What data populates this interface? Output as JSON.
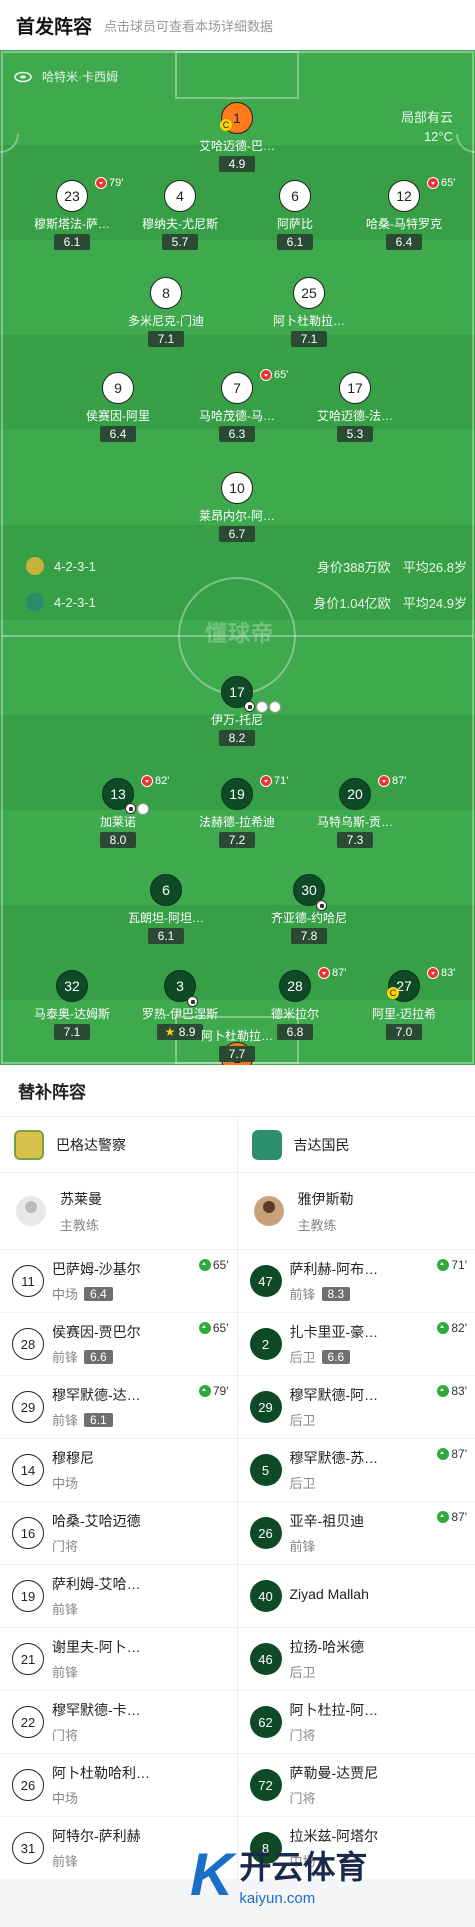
{
  "header": {
    "title": "首发阵容",
    "subtitle": "点击球员可查看本场详细数据"
  },
  "pitch": {
    "venue": "哈特米·卡西姆",
    "weather": {
      "condition": "局部有云",
      "temp": "12°C"
    },
    "watermark": "懂球帝",
    "home_team_row": {
      "formation": "4-2-3-1",
      "value": "身价388万欧",
      "avg_age": "平均26.8岁"
    },
    "away_team_row": {
      "formation": "4-2-3-1",
      "value": "身价1.04亿欧",
      "avg_age": "平均24.9岁"
    }
  },
  "home_players": [
    {
      "num": "1",
      "name": "艾哈迈德-巴…",
      "rating": "4.9",
      "captain": "C"
    },
    {
      "num": "23",
      "name": "穆斯塔法-萨…",
      "rating": "6.1",
      "sub_minute": "79'"
    },
    {
      "num": "4",
      "name": "穆纳夫-尤尼斯",
      "rating": "5.7"
    },
    {
      "num": "6",
      "name": "阿萨比",
      "rating": "6.1"
    },
    {
      "num": "12",
      "name": "哈桑-马特罗克",
      "rating": "6.4",
      "sub_minute": "65'"
    },
    {
      "num": "8",
      "name": "多米尼克-门迪",
      "rating": "7.1"
    },
    {
      "num": "25",
      "name": "阿卜杜勒拉…",
      "rating": "7.1"
    },
    {
      "num": "9",
      "name": "侯赛因-阿里",
      "rating": "6.4"
    },
    {
      "num": "7",
      "name": "马哈茂德-马…",
      "rating": "6.3",
      "sub_minute": "65'"
    },
    {
      "num": "17",
      "name": "艾哈迈德-法…",
      "rating": "5.3"
    },
    {
      "num": "10",
      "name": "莱昂内尔-阿…",
      "rating": "6.7"
    }
  ],
  "away_players": [
    {
      "num": "17",
      "name": "伊万-托尼",
      "rating": "8.2"
    },
    {
      "num": "13",
      "name": "加莱诺",
      "rating": "8.0",
      "sub_minute": "82'"
    },
    {
      "num": "19",
      "name": "法赫德-拉希迪",
      "rating": "7.2",
      "sub_minute": "71'"
    },
    {
      "num": "20",
      "name": "马特乌斯-贡…",
      "rating": "7.3",
      "sub_minute": "87'"
    },
    {
      "num": "6",
      "name": "瓦朗坦-阿坦…",
      "rating": "6.1"
    },
    {
      "num": "30",
      "name": "齐亚德-约哈尼",
      "rating": "7.8"
    },
    {
      "num": "32",
      "name": "马泰奥-达姆斯",
      "rating": "7.1"
    },
    {
      "num": "3",
      "name": "罗热-伊巴涅斯",
      "rating": "8.9"
    },
    {
      "num": "28",
      "name": "德米拉尔",
      "rating": "6.8",
      "sub_minute": "87'"
    },
    {
      "num": "27",
      "name": "阿里-迈拉希",
      "rating": "7.0",
      "sub_minute": "83'",
      "captain": "C"
    },
    {
      "num": "1",
      "name": "阿卜杜勒拉…",
      "rating": "7.7"
    }
  ],
  "subs": {
    "title": "替补阵容",
    "home": {
      "team": "巴格达警察",
      "coach": {
        "name": "苏莱曼",
        "role": "主教练"
      },
      "players": [
        {
          "num": "11",
          "name": "巴萨姆-沙基尔",
          "pos": "中场",
          "rating": "6.4",
          "in": "65'"
        },
        {
          "num": "28",
          "name": "侯赛因-贾巴尔",
          "pos": "前锋",
          "rating": "6.6",
          "in": "65'"
        },
        {
          "num": "29",
          "name": "穆罕默德-达…",
          "pos": "前锋",
          "rating": "6.1",
          "in": "79'"
        },
        {
          "num": "14",
          "name": "穆穆尼",
          "pos": "中场"
        },
        {
          "num": "16",
          "name": "哈桑-艾哈迈德",
          "pos": "门将"
        },
        {
          "num": "19",
          "name": "萨利姆-艾哈…",
          "pos": "前锋"
        },
        {
          "num": "21",
          "name": "谢里夫-阿卜…",
          "pos": "前锋"
        },
        {
          "num": "22",
          "name": "穆罕默德-卡…",
          "pos": "门将"
        },
        {
          "num": "26",
          "name": "阿卜杜勒哈利…",
          "pos": "中场"
        },
        {
          "num": "31",
          "name": "阿特尔-萨利赫",
          "pos": "前锋"
        }
      ]
    },
    "away": {
      "team": "吉达国民",
      "coach": {
        "name": "雅伊斯勒",
        "role": "主教练"
      },
      "players": [
        {
          "num": "47",
          "name": "萨利赫-阿布…",
          "pos": "前锋",
          "rating": "8.3",
          "in": "71'"
        },
        {
          "num": "2",
          "name": "扎卡里亚-豪…",
          "pos": "后卫",
          "rating": "6.6",
          "in": "82'"
        },
        {
          "num": "29",
          "name": "穆罕默德-阿…",
          "pos": "后卫",
          "in": "83'"
        },
        {
          "num": "5",
          "name": "穆罕默德-苏…",
          "pos": "后卫",
          "in": "87'"
        },
        {
          "num": "26",
          "name": "亚辛-祖贝迪",
          "pos": "前锋",
          "in": "87'"
        },
        {
          "num": "40",
          "name": "Ziyad Mallah",
          "pos": ""
        },
        {
          "num": "46",
          "name": "拉扬-哈米德",
          "pos": "后卫"
        },
        {
          "num": "62",
          "name": "阿卜杜拉-阿…",
          "pos": "门将"
        },
        {
          "num": "72",
          "name": "萨勒曼-达贾尼",
          "pos": "门将"
        },
        {
          "num": "8",
          "name": "拉米兹-阿塔尔",
          "pos": "中场"
        }
      ]
    }
  },
  "logo": {
    "cn": "开云体育",
    "en": "kaiyun.com",
    "mark": "K"
  }
}
